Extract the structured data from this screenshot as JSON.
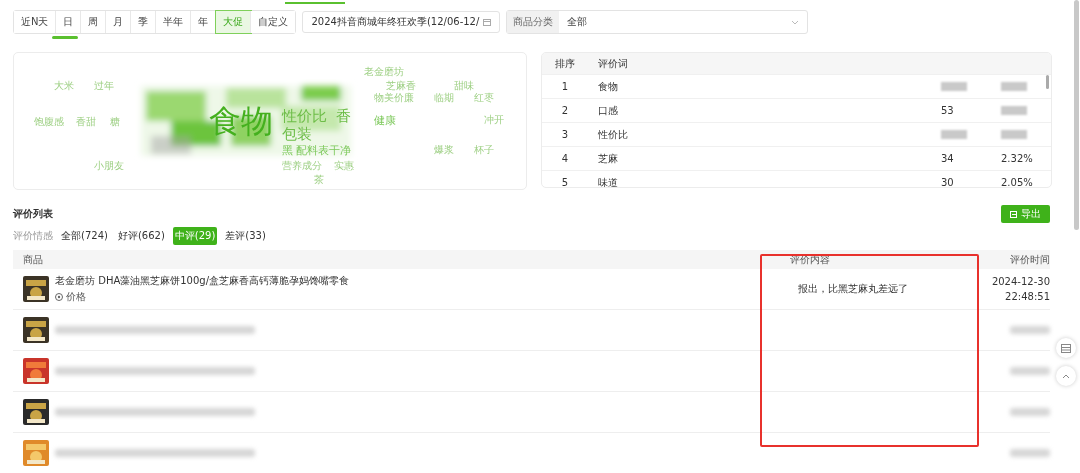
{
  "period_tabs": [
    {
      "label": "近N天",
      "selected": false
    },
    {
      "label": "日",
      "selected": false
    },
    {
      "label": "周",
      "selected": false
    },
    {
      "label": "月",
      "selected": false
    },
    {
      "label": "季",
      "selected": false
    },
    {
      "label": "半年",
      "selected": false
    },
    {
      "label": "年",
      "selected": false
    },
    {
      "label": "大促",
      "selected": true
    },
    {
      "label": "自定义",
      "selected": false
    }
  ],
  "promo_picker": {
    "value": "2024抖音商城年终狂欢季(12/06-12/"
  },
  "category_filter": {
    "label": "商品分类",
    "value": "全部"
  },
  "word_cloud": [
    {
      "text": "老金磨坊",
      "kind": "small"
    },
    {
      "text": "大米",
      "kind": "small"
    },
    {
      "text": "过年",
      "kind": "small"
    },
    {
      "text": "芝麻香",
      "kind": "small"
    },
    {
      "text": "甜味",
      "kind": "small"
    },
    {
      "text": "物美价廉",
      "kind": "small"
    },
    {
      "text": "临期",
      "kind": "small"
    },
    {
      "text": "红枣",
      "kind": "small"
    },
    {
      "text": "饱腹感",
      "kind": "small"
    },
    {
      "text": "香甜",
      "kind": "small"
    },
    {
      "text": "糖",
      "kind": "small"
    },
    {
      "text": "食物",
      "kind": "huge"
    },
    {
      "text": "性价比",
      "kind": "big"
    },
    {
      "text": "香",
      "kind": "big"
    },
    {
      "text": "健康",
      "kind": "mid"
    },
    {
      "text": "冲开",
      "kind": "small"
    },
    {
      "text": "包装",
      "kind": "big"
    },
    {
      "text": "黑 配料表干净",
      "kind": "mid"
    },
    {
      "text": "爆浆",
      "kind": "small"
    },
    {
      "text": "杯子",
      "kind": "small"
    },
    {
      "text": "小朋友",
      "kind": "small"
    },
    {
      "text": "营养成分",
      "kind": "small"
    },
    {
      "text": "实惠",
      "kind": "small"
    },
    {
      "text": "茶",
      "kind": "small"
    }
  ],
  "rank_table": {
    "columns": [
      "排序",
      "评价词"
    ],
    "rows": [
      {
        "rank": "1",
        "word": "食物"
      },
      {
        "rank": "2",
        "word": "口感",
        "count": "53"
      },
      {
        "rank": "3",
        "word": "性价比"
      },
      {
        "rank": "4",
        "word": "芝麻",
        "count": "34",
        "share": "2.32%"
      },
      {
        "rank": "5",
        "word": "味道",
        "count": "30",
        "share": "2.05%"
      }
    ]
  },
  "review_list": {
    "title": "评价列表",
    "export_button": "导出",
    "filter_label": "评价情感",
    "filters": [
      {
        "label": "全部(724)",
        "selected": false
      },
      {
        "label": "好评(662)",
        "selected": false
      },
      {
        "label": "中评(29)",
        "selected": true
      },
      {
        "label": "差评(33)",
        "selected": false
      }
    ],
    "columns": [
      "商品",
      "评价内容",
      "评价时间"
    ],
    "rows": [
      {
        "redacted": false,
        "product": "老金磨坊 DHA藻油黑芝麻饼100g/盒芝麻香高钙薄脆孕妈馋嘴零食",
        "tag": "价格",
        "content": "报出，比黑芝麻丸差远了",
        "date": "2024-12-30",
        "time": "22:48:51"
      },
      {
        "redacted": true
      },
      {
        "redacted": true
      },
      {
        "redacted": true
      },
      {
        "redacted": true
      }
    ]
  }
}
